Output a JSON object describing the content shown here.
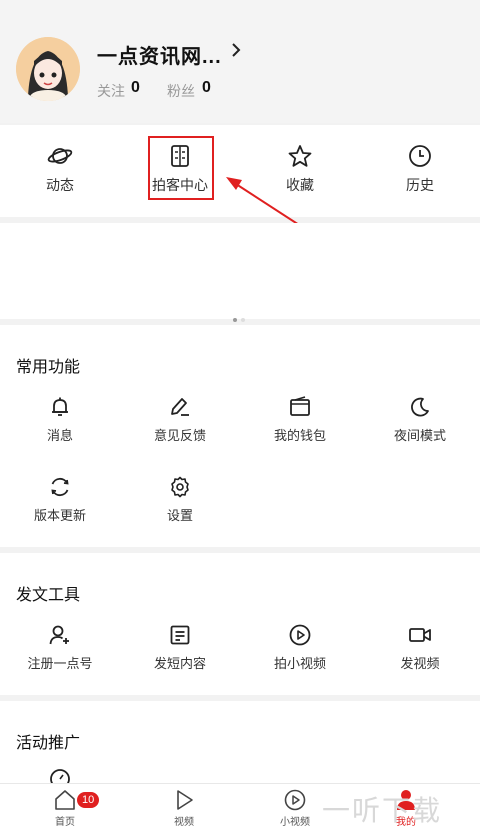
{
  "profile": {
    "username": "一点资讯网...",
    "following_label": "关注",
    "following_count": "0",
    "fans_label": "粉丝",
    "fans_count": "0"
  },
  "quick_actions": [
    {
      "label": "动态",
      "icon": "planet-icon"
    },
    {
      "label": "拍客中心",
      "icon": "notebook-icon"
    },
    {
      "label": "收藏",
      "icon": "star-icon"
    },
    {
      "label": "历史",
      "icon": "clock-icon"
    }
  ],
  "common": {
    "title": "常用功能",
    "items": [
      {
        "label": "消息",
        "icon": "bell-icon"
      },
      {
        "label": "意见反馈",
        "icon": "pencil-icon"
      },
      {
        "label": "我的钱包",
        "icon": "wallet-icon"
      },
      {
        "label": "夜间模式",
        "icon": "moon-icon"
      },
      {
        "label": "版本更新",
        "icon": "refresh-icon"
      },
      {
        "label": "设置",
        "icon": "gear-icon"
      }
    ]
  },
  "publish": {
    "title": "发文工具",
    "items": [
      {
        "label": "注册一点号",
        "icon": "add-user-icon"
      },
      {
        "label": "发短内容",
        "icon": "document-icon"
      },
      {
        "label": "拍小视频",
        "icon": "play-circle-icon"
      },
      {
        "label": "发视频",
        "icon": "video-camera-icon"
      }
    ]
  },
  "promo": {
    "title": "活动推广"
  },
  "tabbar": {
    "home": {
      "label": "首页",
      "badge": "10"
    },
    "video": {
      "label": "视频"
    },
    "short_video": {
      "label": "小视频"
    },
    "mine": {
      "label": "我的"
    }
  },
  "watermark": "一听下载",
  "colors": {
    "accent": "#e02020",
    "annotation": "#e02020"
  }
}
